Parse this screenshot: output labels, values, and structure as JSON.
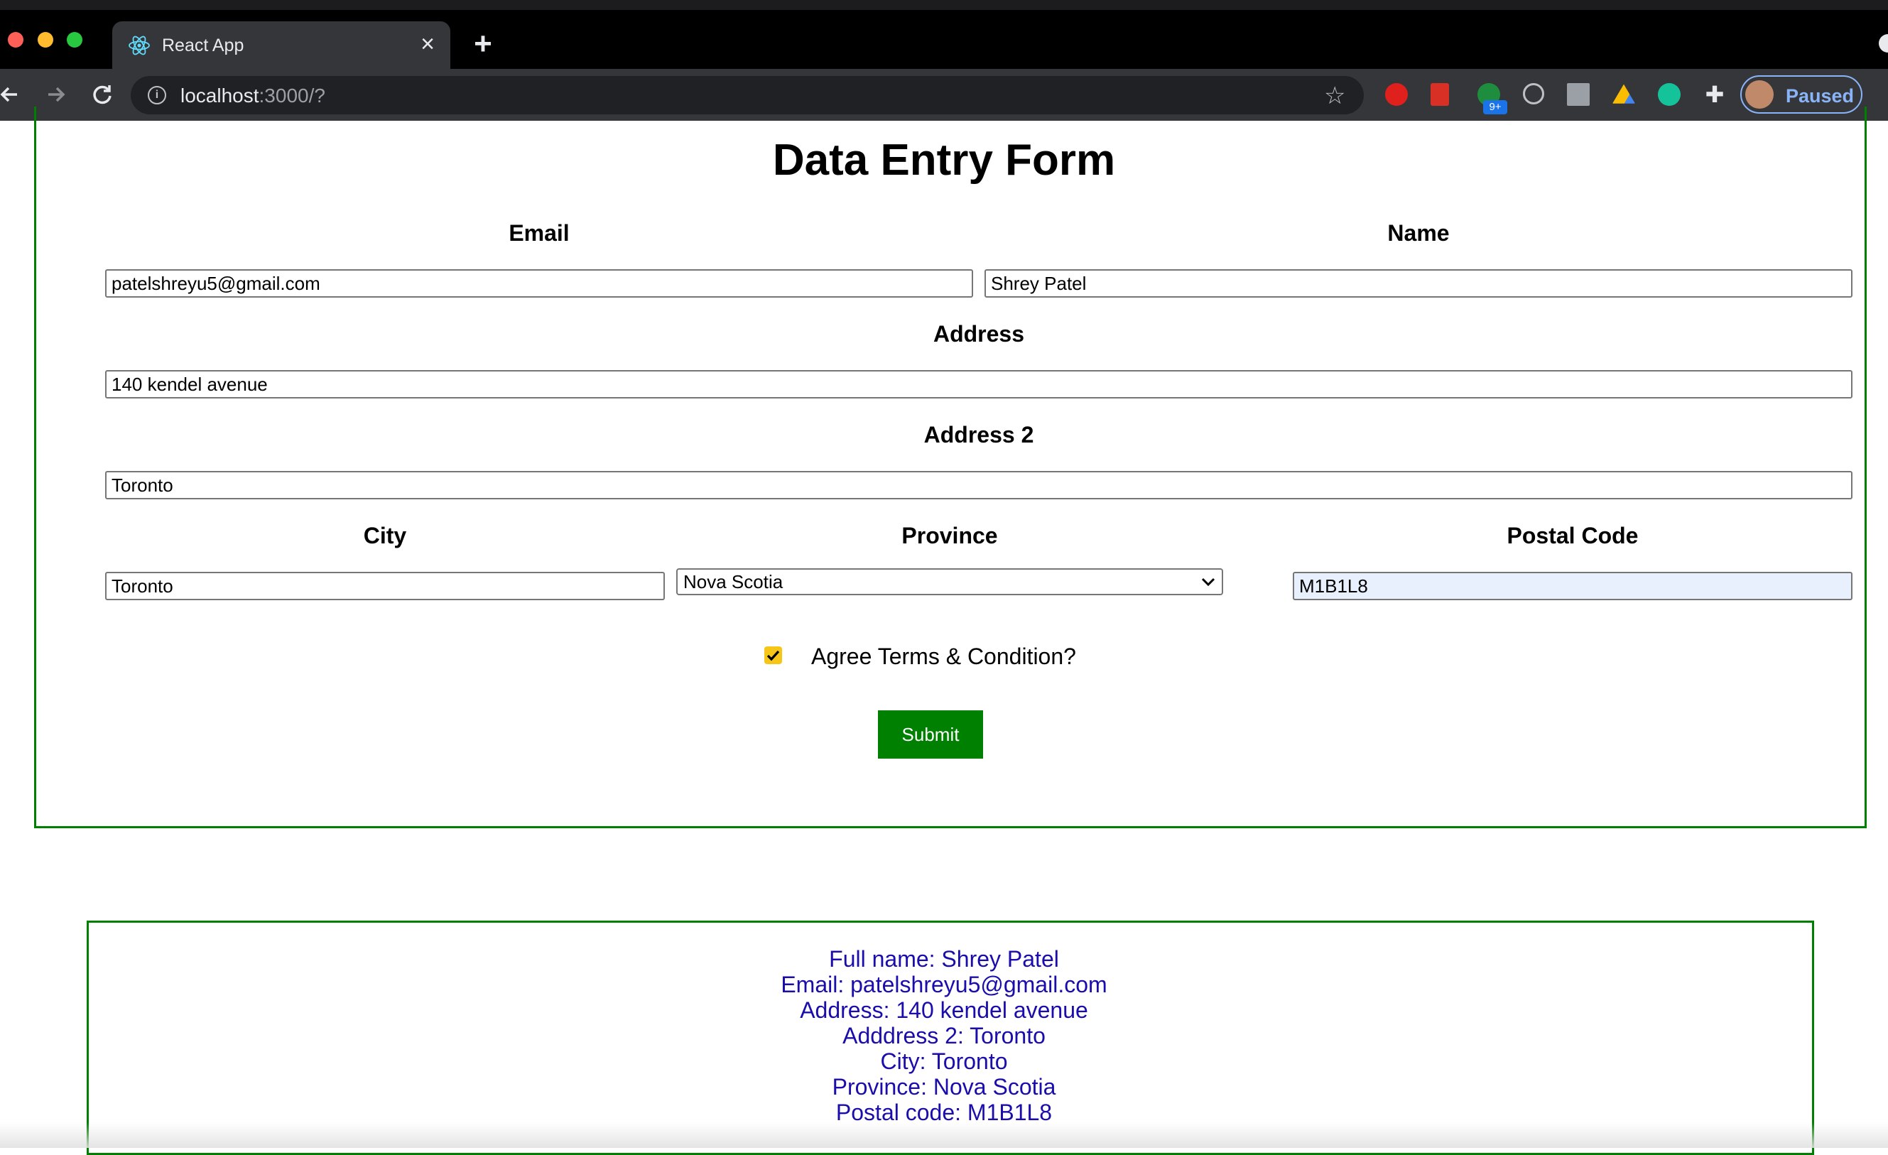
{
  "browser": {
    "tab_title": "React App",
    "new_tab_symbol": "+",
    "close_symbol": "×",
    "url_host": "localhost",
    "url_rest": ":3000/?",
    "extension_badge": "9+",
    "profile_label": "Paused"
  },
  "form": {
    "title": "Data Entry Form",
    "email_label": "Email",
    "email_value": "patelshreyu5@gmail.com",
    "name_label": "Name",
    "name_value": "Shrey Patel",
    "address_label": "Address",
    "address_value": "140 kendel avenue",
    "address2_label": "Address 2",
    "address2_value": "Toronto",
    "city_label": "City",
    "city_value": "Toronto",
    "province_label": "Province",
    "province_value": "Nova Scotia",
    "postal_label": "Postal Code",
    "postal_value": "M1B1L8",
    "agree_label": "Agree Terms & Condition?",
    "agree_checked": true,
    "submit_label": "Submit"
  },
  "result": {
    "lines": [
      "Full name: Shrey Patel",
      "Email: patelshreyu5@gmail.com",
      "Address: 140 kendel avenue",
      "Adddress 2: Toronto",
      "City: Toronto",
      "Province: Nova Scotia",
      "Postal code: M1B1L8"
    ]
  },
  "colors": {
    "accent_border": "#008000",
    "submit_bg": "#008000",
    "result_text": "#1a0dab",
    "checkbox": "#f5c518"
  },
  "icons": {
    "tab_favicon": "react-logo-icon",
    "back": "arrow-left-icon",
    "forward": "arrow-right-icon",
    "reload": "reload-icon",
    "info": "info-icon",
    "bookmark": "star-icon",
    "extensions": "puzzle-icon",
    "province_dropdown": "chevron-down-icon"
  }
}
